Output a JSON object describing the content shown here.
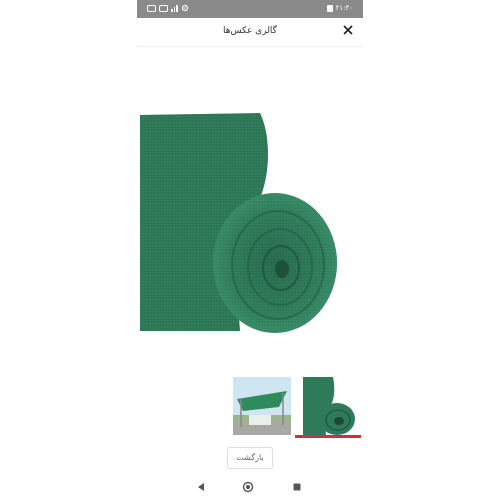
{
  "status_bar": {
    "time": "۲۱:۴۰",
    "background": "#8a8a8a"
  },
  "header": {
    "title": "گالری عکس‌ها",
    "close_icon": "close-icon"
  },
  "gallery": {
    "selected_index": 1,
    "thumbnails": [
      {
        "icon": "shade-sail-photo"
      },
      {
        "icon": "green-mesh-roll-photo"
      }
    ],
    "accent_color": "#d0303a",
    "product_color": "#2e7d5b"
  },
  "actions": {
    "back_label": "بازگشت"
  },
  "nav_bar": {
    "icons": [
      "back-triangle-icon",
      "home-circle-icon",
      "recents-square-icon"
    ]
  }
}
